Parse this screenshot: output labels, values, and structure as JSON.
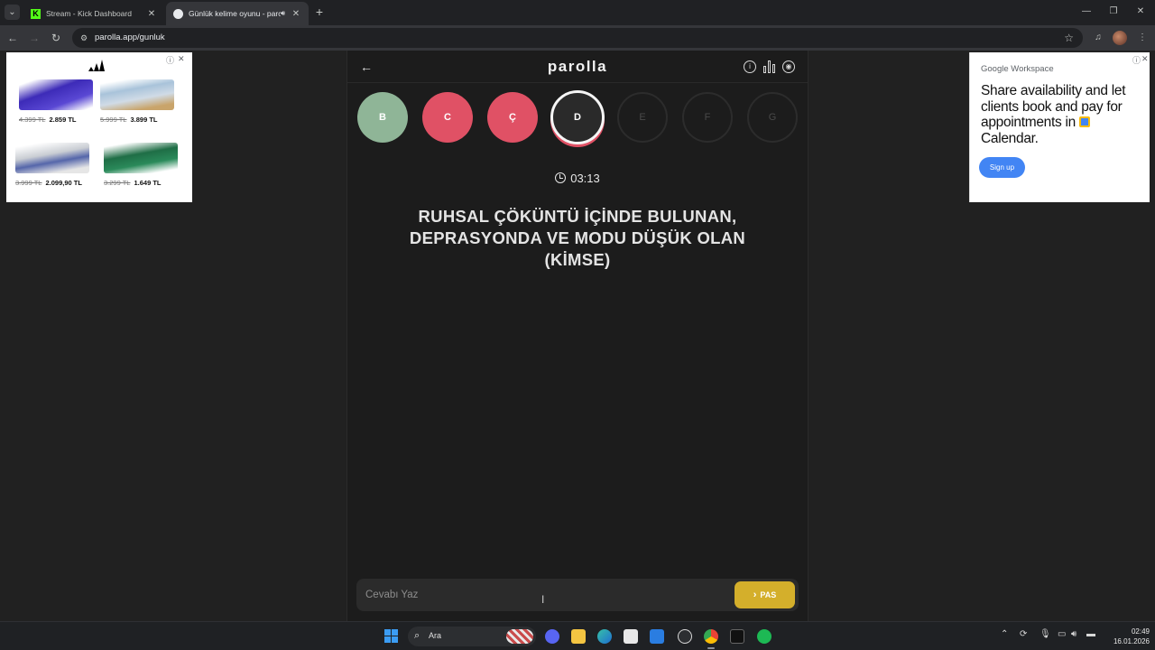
{
  "browser": {
    "tabs": [
      {
        "title": "Stream - Kick Dashboard",
        "active": false,
        "favicon_icon": "kick-icon"
      },
      {
        "title": "Günlük kelime oyunu - parolla",
        "active": true,
        "favicon_icon": "parolla-icon"
      }
    ],
    "url": "parolla.app/gunluk"
  },
  "ad_left": {
    "brand_icon": "adidas-logo-icon",
    "products": [
      {
        "old_price": "4.399 TL",
        "price": "2.859 TL",
        "color": "#3d2bb8"
      },
      {
        "old_price": "5.999 TL",
        "price": "3.899 TL",
        "color": "#a9c3da"
      },
      {
        "old_price": "3.999 TL",
        "price": "2.099,90 TL",
        "color": "#c9cdd3"
      },
      {
        "old_price": "3.299 TL",
        "price": "1.649 TL",
        "color": "#1f6e46"
      }
    ]
  },
  "ad_right": {
    "brand": "Google Workspace",
    "headline_1": "Share availability and let clients book and pay for appointments in",
    "headline_2": "Calendar.",
    "cta": "Sign up"
  },
  "game": {
    "logo": "parolla",
    "letters": [
      {
        "letter": "B",
        "state": "correct"
      },
      {
        "letter": "C",
        "state": "wrong"
      },
      {
        "letter": "Ç",
        "state": "wrong"
      },
      {
        "letter": "D",
        "state": "current"
      },
      {
        "letter": "E",
        "state": "pending"
      },
      {
        "letter": "F",
        "state": "pending"
      },
      {
        "letter": "G",
        "state": "pending"
      }
    ],
    "timer": "03:13",
    "question": "RUHSAL ÇÖKÜNTÜ İÇİNDE BULUNAN, DEPRASYONDA VE MODU DÜŞÜK OLAN (KİMSE)",
    "answer_placeholder": "Cevabı Yaz",
    "pass_label": "PAS"
  },
  "taskbar": {
    "search_label": "Ara",
    "time": "02:49",
    "date": "16.01.2026"
  },
  "colors": {
    "correct": "#8fb597",
    "wrong": "#e05165",
    "pass": "#d4af2b",
    "background": "#1c1c1c"
  }
}
